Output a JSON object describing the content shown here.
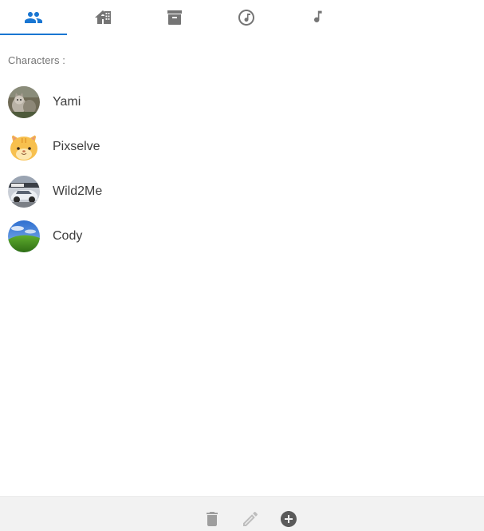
{
  "tabs": [
    {
      "icon": "people-icon",
      "active": true
    },
    {
      "icon": "city-buildings-icon",
      "active": false
    },
    {
      "icon": "archive-box-icon",
      "active": false
    },
    {
      "icon": "music-disc-icon",
      "active": false
    },
    {
      "icon": "music-note-icon",
      "active": false
    }
  ],
  "colors": {
    "accent": "#1976d2",
    "icon_default": "#757575",
    "toolbar_bg": "#f2f2f2"
  },
  "section": {
    "label": "Characters :"
  },
  "characters": [
    {
      "name": "Yami",
      "avatar": "cat-photo"
    },
    {
      "name": "Pixselve",
      "avatar": "hamster-emoji"
    },
    {
      "name": "Wild2Me",
      "avatar": "car-photo"
    },
    {
      "name": "Cody",
      "avatar": "green-hill-landscape"
    }
  ],
  "toolbar": {
    "items": [
      {
        "icon": "trash-icon",
        "enabled": false
      },
      {
        "icon": "pencil-icon",
        "enabled": false
      },
      {
        "icon": "add-circle-icon",
        "enabled": true
      }
    ]
  }
}
